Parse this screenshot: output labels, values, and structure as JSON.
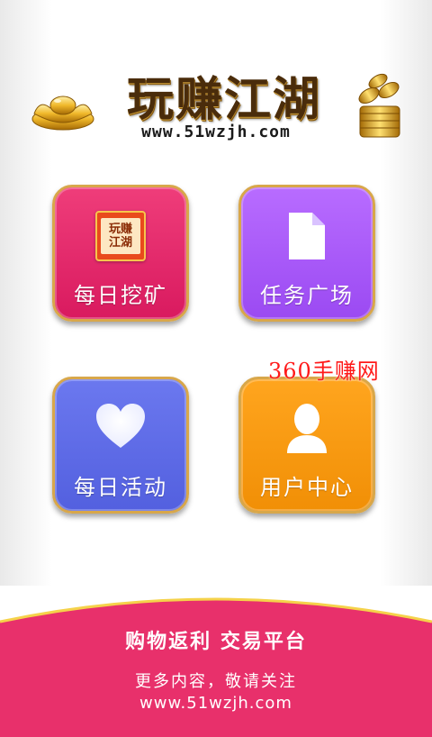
{
  "header": {
    "title": "玩赚江湖",
    "subtitle": "www.51wzjh.com"
  },
  "tiles": [
    {
      "label": "每日挖矿",
      "icon": "app-logo-icon",
      "color": "#e62a6b"
    },
    {
      "label": "任务广场",
      "icon": "document-icon",
      "color": "#a85cf8"
    },
    {
      "label": "每日活动",
      "icon": "heart-icon",
      "color": "#5f6be6"
    },
    {
      "label": "用户中心",
      "icon": "user-icon",
      "color": "#f7990f"
    }
  ],
  "app_icon_text": [
    "玩赚",
    "江湖"
  ],
  "watermark": "360手赚网",
  "footer": {
    "slogan": "购物返利  交易平台",
    "follow": "更多内容，敬请关注",
    "url": "www.51wzjh.com"
  },
  "colors": {
    "footer": "#e8306b",
    "tile_border": "#d8a74a",
    "watermark": "#ff1a1a"
  }
}
